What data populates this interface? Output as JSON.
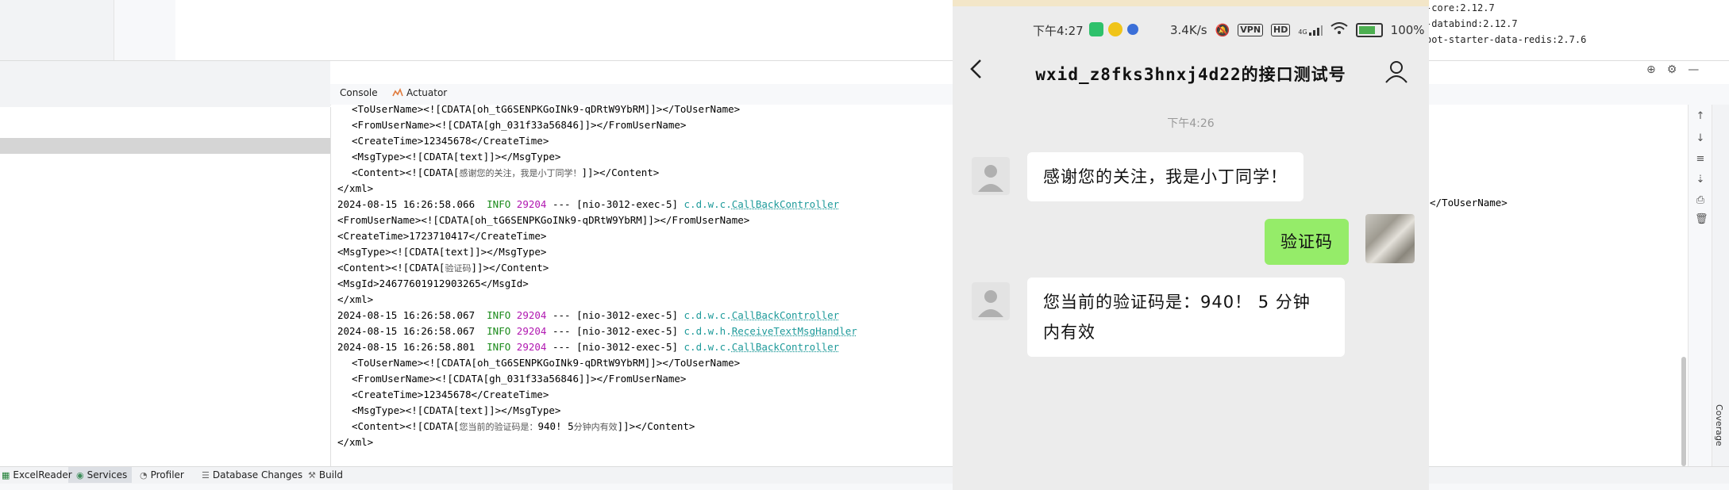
{
  "ide": {
    "dependencies": [
      "-core:2.12.7",
      "-databind:2.12.7",
      "oot-starter-data-redis:2.7.6"
    ],
    "tool_tabs": {
      "console": "Console",
      "actuator": "Actuator"
    },
    "console_lines": [
      {
        "indent": true,
        "parts": [
          {
            "t": "<ToUserName><![CDATA[oh_tG6SENPKGoINk9-qDRtW9YbRM]]></ToUserName>"
          }
        ]
      },
      {
        "indent": true,
        "parts": [
          {
            "t": "<FromUserName><![CDATA[gh_031f33a56846]]></FromUserName>"
          }
        ]
      },
      {
        "indent": true,
        "parts": [
          {
            "t": "<CreateTime>12345678</CreateTime>"
          }
        ]
      },
      {
        "indent": true,
        "parts": [
          {
            "t": "<MsgType><![CDATA[text]]></MsgType>"
          }
        ]
      },
      {
        "indent": true,
        "parts": [
          {
            "t": "<Content><![CDATA["
          },
          {
            "t": "感谢您的关注，我是小丁同学！",
            "c": "cn"
          },
          {
            "t": "]]></Content>"
          }
        ]
      },
      {
        "indent": false,
        "parts": [
          {
            "t": "</xml>"
          }
        ]
      },
      {
        "indent": false,
        "parts": [
          {
            "t": "2024-08-15 16:26:58.066  "
          },
          {
            "t": "INFO",
            "c": "info"
          },
          {
            "t": " "
          },
          {
            "t": "29204",
            "c": "pid"
          },
          {
            "t": " --- [nio-3012-exec-5] "
          },
          {
            "t": "c.d.w.c.",
            "c": "cls"
          },
          {
            "t": "CallBackController",
            "c": "cls",
            "u": true
          }
        ]
      },
      {
        "indent": false,
        "parts": [
          {
            "t": "<FromUserName><![CDATA[oh_tG6SENPKGoINk9-qDRtW9YbRM]]></FromUserName>"
          }
        ]
      },
      {
        "indent": false,
        "parts": [
          {
            "t": "<CreateTime>1723710417</CreateTime>"
          }
        ]
      },
      {
        "indent": false,
        "parts": [
          {
            "t": "<MsgType><![CDATA[text]]></MsgType>"
          }
        ]
      },
      {
        "indent": false,
        "parts": [
          {
            "t": "<Content><![CDATA["
          },
          {
            "t": "验证码",
            "c": "cn"
          },
          {
            "t": "]]></Content>"
          }
        ]
      },
      {
        "indent": false,
        "parts": [
          {
            "t": "<MsgId>24677601912903265</MsgId>"
          }
        ]
      },
      {
        "indent": false,
        "parts": [
          {
            "t": "</xml>"
          }
        ]
      },
      {
        "indent": false,
        "parts": [
          {
            "t": "2024-08-15 16:26:58.067  "
          },
          {
            "t": "INFO",
            "c": "info"
          },
          {
            "t": " "
          },
          {
            "t": "29204",
            "c": "pid"
          },
          {
            "t": " --- [nio-3012-exec-5] "
          },
          {
            "t": "c.d.w.c.",
            "c": "cls"
          },
          {
            "t": "CallBackController",
            "c": "cls",
            "u": true
          }
        ]
      },
      {
        "indent": false,
        "parts": [
          {
            "t": "2024-08-15 16:26:58.067  "
          },
          {
            "t": "INFO",
            "c": "info"
          },
          {
            "t": " "
          },
          {
            "t": "29204",
            "c": "pid"
          },
          {
            "t": " --- [nio-3012-exec-5] "
          },
          {
            "t": "c.d.w.h.",
            "c": "cls"
          },
          {
            "t": "ReceiveTextMsgHandler",
            "c": "cls",
            "u": true
          }
        ]
      },
      {
        "indent": false,
        "parts": [
          {
            "t": "2024-08-15 16:26:58.801  "
          },
          {
            "t": "INFO",
            "c": "info"
          },
          {
            "t": " "
          },
          {
            "t": "29204",
            "c": "pid"
          },
          {
            "t": " --- [nio-3012-exec-5] "
          },
          {
            "t": "c.d.w.c.",
            "c": "cls"
          },
          {
            "t": "CallBackController",
            "c": "cls",
            "u": true
          }
        ]
      },
      {
        "indent": true,
        "parts": [
          {
            "t": "<ToUserName><![CDATA[oh_tG6SENPKGoINk9-qDRtW9YbRM]]></ToUserName>"
          }
        ]
      },
      {
        "indent": true,
        "parts": [
          {
            "t": "<FromUserName><![CDATA[gh_031f33a56846]]></FromUserName>"
          }
        ]
      },
      {
        "indent": true,
        "parts": [
          {
            "t": "<CreateTime>12345678</CreateTime>"
          }
        ]
      },
      {
        "indent": true,
        "parts": [
          {
            "t": "<MsgType><![CDATA[text]]></MsgType>"
          }
        ]
      },
      {
        "indent": true,
        "parts": [
          {
            "t": "<Content><![CDATA["
          },
          {
            "t": "您当前的验证码是：",
            "c": "cn"
          },
          {
            "t": "940! 5"
          },
          {
            "t": "分钟内有效",
            "c": "cn"
          },
          {
            "t": "]]></Content>"
          }
        ]
      },
      {
        "indent": false,
        "parts": [
          {
            "t": "</xml>"
          }
        ]
      }
    ],
    "right_console_fragment": "</ToUserName>",
    "coverage_label": "Coverage",
    "bottom_tabs": [
      "ExcelReader",
      "Services",
      "Profiler",
      "Database Changes",
      "Build"
    ],
    "colors": {
      "info": "#1a8a1a",
      "pid": "#b118b1",
      "class": "#1e9a9a",
      "selected_tab": "#dcdfe4"
    }
  },
  "phone": {
    "status": {
      "time": "下午4:27",
      "speed": "3.4K/s",
      "vpn": "VPN",
      "hd": "HD",
      "network": "4G",
      "battery": "100%"
    },
    "chat_title": "wxid_z8fks3hnxj4d22的接口测试号",
    "message_time": "下午4:26",
    "messages": [
      {
        "from": "other",
        "text": "感谢您的关注，我是小丁同学！"
      },
      {
        "from": "me",
        "text": "验证码"
      },
      {
        "from": "other",
        "text_line1": "您当前的验证码是：940！ 5 分钟",
        "text_line2": "内有效"
      }
    ],
    "colors": {
      "bubble_me": "#95ec69",
      "bubble_other": "#ffffff",
      "chat_bg": "#ececec"
    }
  }
}
